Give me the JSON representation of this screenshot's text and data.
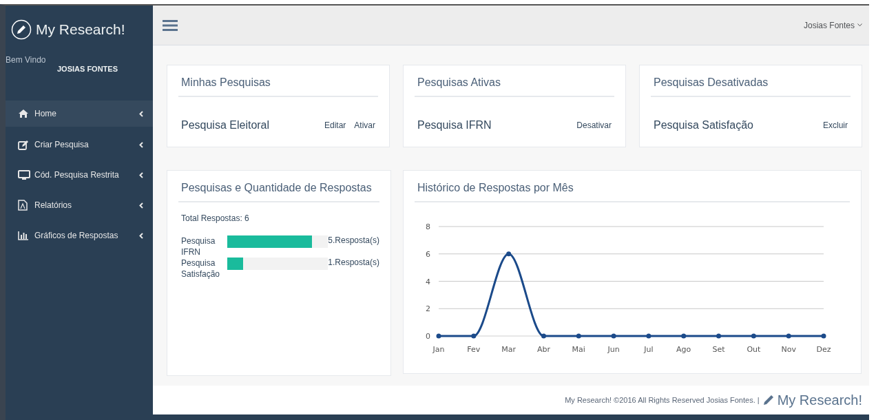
{
  "brand": {
    "title": "My Research!"
  },
  "welcome": {
    "greeting": "Bem Vindo",
    "user": "JOSIAS FONTES"
  },
  "sidebar": {
    "items": [
      {
        "label": "Home",
        "selected": true
      },
      {
        "label": "Criar Pesquisa",
        "selected": false
      },
      {
        "label": "Cód. Pesquisa Restrita",
        "selected": false
      },
      {
        "label": "Relatórios",
        "selected": false
      },
      {
        "label": "Gráficos de Respostas",
        "selected": false
      }
    ]
  },
  "header": {
    "user": "Josias Fontes"
  },
  "cards": [
    {
      "title": "Minhas Pesquisas",
      "item": "Pesquisa Eleitoral",
      "actions": [
        "Editar",
        "Ativar"
      ]
    },
    {
      "title": "Pesquisas Ativas",
      "item": "Pesquisa IFRN",
      "actions": [
        "Desativar"
      ]
    },
    {
      "title": "Pesquisas Desativadas",
      "item": "Pesquisa Satisfação",
      "actions": [
        "Excluir"
      ]
    }
  ],
  "responses": {
    "title": "Pesquisas e Quantidade de Respostas",
    "total": "Total Respostas: 6",
    "rows": [
      {
        "label": "Pesquisa IFRN",
        "level": 0.84,
        "count": "5.Resposta(s)"
      },
      {
        "label": "Pesquisa Satisfação",
        "level": 0.16,
        "count": "1.Resposta(s)"
      }
    ]
  },
  "history": {
    "title": "Histórico de Respostas por Mês",
    "chart_data": {
      "type": "line",
      "categories": [
        "Jan",
        "Fev",
        "Mar",
        "Abr",
        "Mai",
        "Jun",
        "Jul",
        "Ago",
        "Set",
        "Out",
        "Nov",
        "Dez"
      ],
      "grid": true,
      "ylim": [
        0,
        8
      ],
      "yticks": [
        0,
        2,
        4,
        6,
        8
      ],
      "series": [
        {
          "color": "#1b4a8a",
          "marker": true,
          "values": [
            0,
            0,
            6,
            0,
            0,
            0,
            0,
            0,
            0,
            0,
            0,
            0
          ]
        }
      ]
    }
  },
  "footer": {
    "text": "My Research! ©2016 All Rights Reserved Josias Fontes. |",
    "brand": "My Research!"
  }
}
